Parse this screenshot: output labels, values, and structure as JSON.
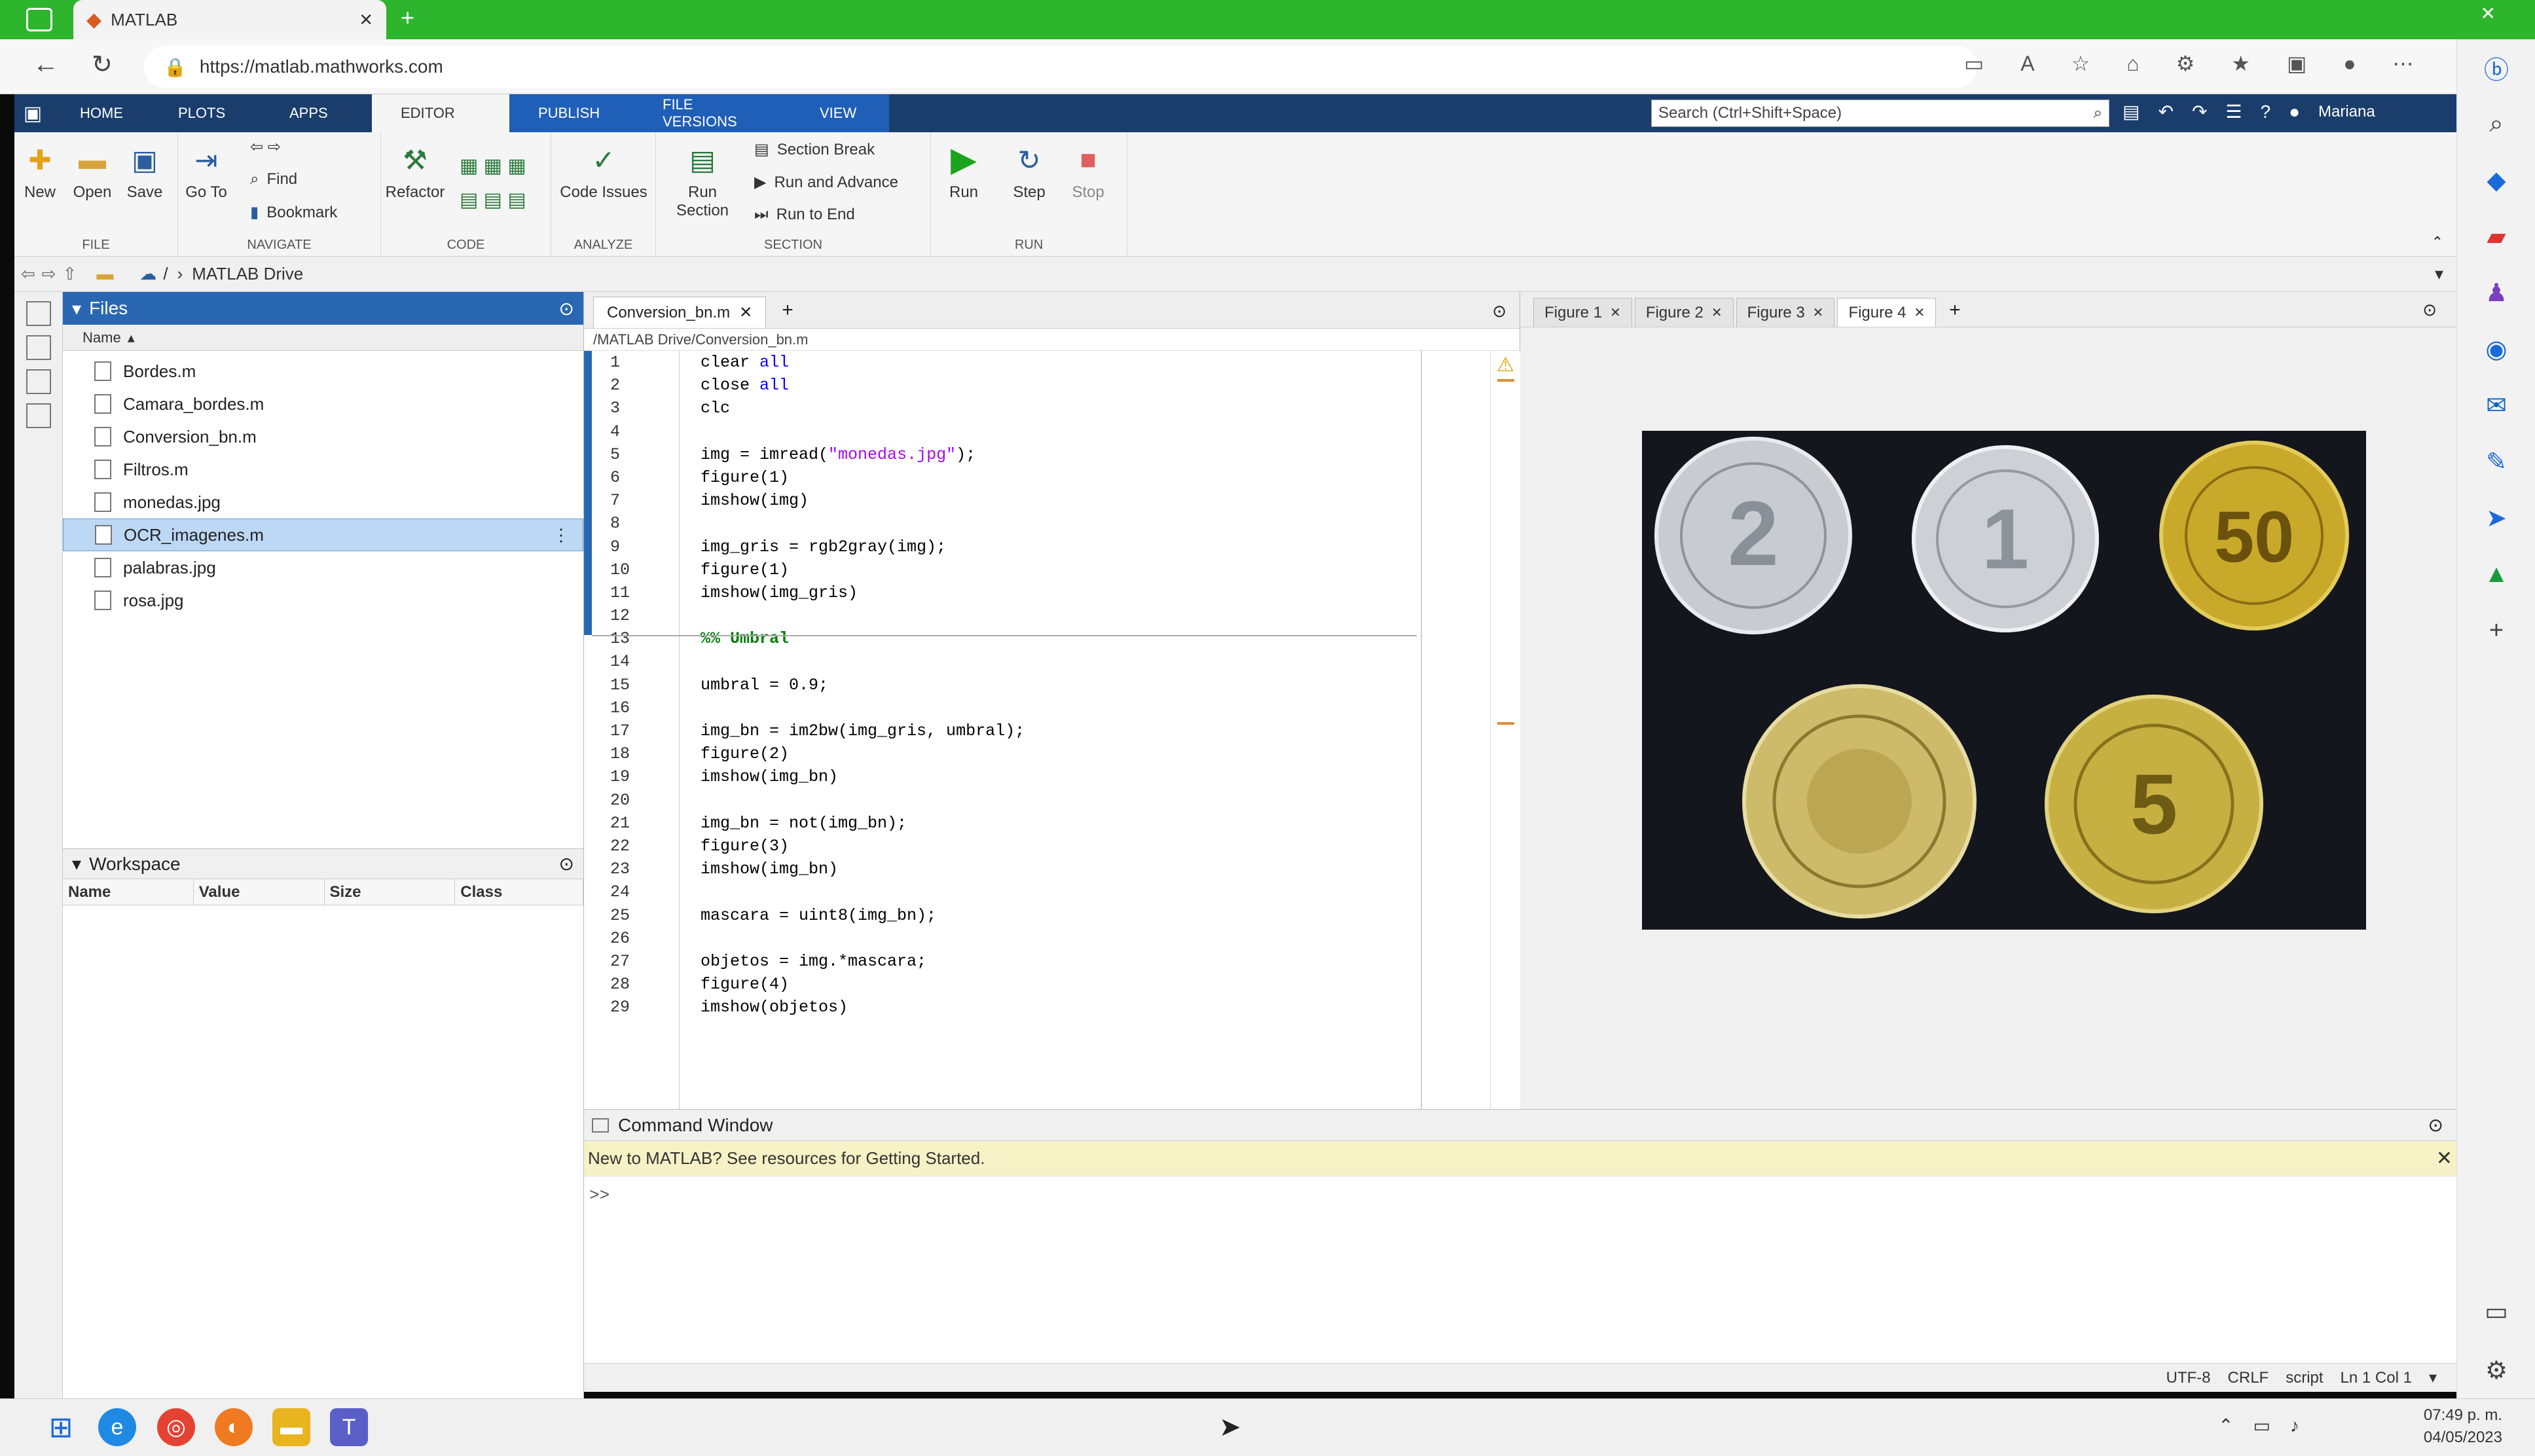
{
  "browser": {
    "tab_title": "MATLAB",
    "url": "https://matlab.mathworks.com"
  },
  "matlab": {
    "tabs": [
      "HOME",
      "PLOTS",
      "APPS",
      "EDITOR",
      "PUBLISH",
      "FILE VERSIONS",
      "VIEW"
    ],
    "active_tab": "EDITOR",
    "search_placeholder": "Search (Ctrl+Shift+Space)",
    "user": "Mariana"
  },
  "toolstrip": {
    "file": {
      "label": "FILE",
      "new": "New",
      "open": "Open",
      "save": "Save"
    },
    "navigate": {
      "label": "NAVIGATE",
      "goto": "Go To",
      "find": "Find",
      "bookmark": "Bookmark"
    },
    "code": {
      "label": "CODE",
      "refactor": "Refactor"
    },
    "analyze": {
      "label": "ANALYZE",
      "code_issues": "Code Issues"
    },
    "section": {
      "label": "SECTION",
      "run_section": "Run Section",
      "section_break": "Section Break",
      "run_advance": "Run and Advance",
      "run_to_end": "Run to End"
    },
    "run": {
      "label": "RUN",
      "run": "Run",
      "step": "Step",
      "stop": "Stop"
    }
  },
  "path": {
    "root": "/",
    "folder": "MATLAB Drive"
  },
  "files_panel": {
    "title": "Files",
    "col_name": "Name",
    "files": [
      {
        "name": "Bordes.m",
        "icon": "script-file-icon"
      },
      {
        "name": "Camara_bordes.m",
        "icon": "script-file-icon"
      },
      {
        "name": "Conversion_bn.m",
        "icon": "script-file-icon"
      },
      {
        "name": "Filtros.m",
        "icon": "script-file-icon"
      },
      {
        "name": "monedas.jpg",
        "icon": "image-file-icon"
      },
      {
        "name": "OCR_imagenes.m",
        "icon": "script-file-icon"
      },
      {
        "name": "palabras.jpg",
        "icon": "image-file-icon"
      },
      {
        "name": "rosa.jpg",
        "icon": "image-file-icon"
      }
    ],
    "selected_index": 5
  },
  "workspace": {
    "title": "Workspace",
    "columns": [
      "Name",
      "Value",
      "Size",
      "Class"
    ]
  },
  "editor": {
    "tab": "Conversion_bn.m",
    "path": "/MATLAB Drive/Conversion_bn.m",
    "lines": [
      "clear all",
      "close all",
      "clc",
      "",
      "img = imread(\"monedas.jpg\");",
      "figure(1)",
      "imshow(img)",
      "",
      "img_gris = rgb2gray(img);",
      "figure(1)",
      "imshow(img_gris)",
      "",
      "%% Umbral",
      "",
      "umbral = 0.9;",
      "",
      "img_bn = im2bw(img_gris, umbral);",
      "figure(2)",
      "imshow(img_bn)",
      "",
      "img_bn = not(img_bn);",
      "figure(3)",
      "imshow(img_bn)",
      "",
      "mascara = uint8(img_bn);",
      "",
      "objetos = img.*mascara;",
      "figure(4)",
      "imshow(objetos)"
    ]
  },
  "figures": {
    "tabs": [
      "Figure 1",
      "Figure 2",
      "Figure 3",
      "Figure 4"
    ],
    "active": "Figure 4",
    "image_coin_labels": [
      "2",
      "1",
      "50",
      "",
      "5"
    ]
  },
  "command_window": {
    "title": "Command Window",
    "banner": "New to MATLAB? See resources for Getting Started.",
    "prompt": ">>"
  },
  "status": {
    "encoding": "UTF-8",
    "line_ending": "CRLF",
    "type": "script",
    "position": "Ln 1 Col 1"
  },
  "taskbar": {
    "time": "07:49 p. m.",
    "date": "04/05/2023"
  },
  "colors": {
    "matlab_tab_bar": "#1a3d6c",
    "panel_header": "#2a67b3",
    "browser_tabbar": "#2db52d"
  }
}
